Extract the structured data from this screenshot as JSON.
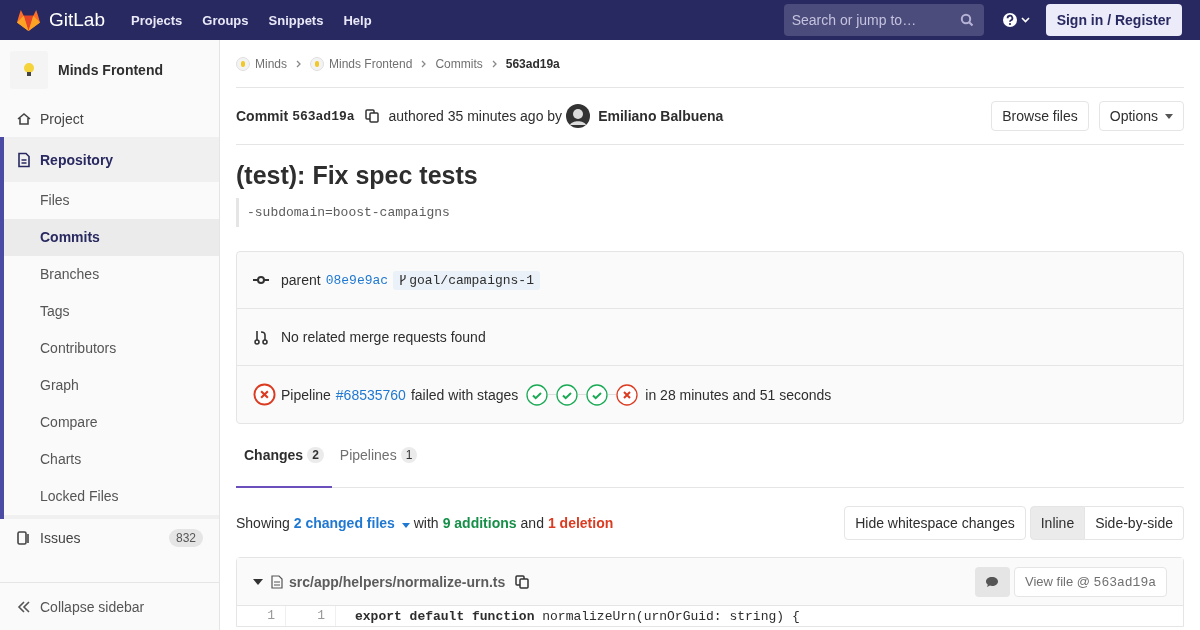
{
  "navbar": {
    "brand": "GitLab",
    "links": [
      "Projects",
      "Groups",
      "Snippets",
      "Help"
    ],
    "search": {
      "placeholder": "Search or jump to…"
    },
    "sign_in": "Sign in / Register"
  },
  "sidebar": {
    "project": "Minds Frontend",
    "items": [
      {
        "label": "Project",
        "selected": false
      },
      {
        "label": "Repository",
        "selected": true,
        "children": [
          {
            "label": "Files",
            "selected": false
          },
          {
            "label": "Commits",
            "selected": true
          },
          {
            "label": "Branches",
            "selected": false
          },
          {
            "label": "Tags",
            "selected": false
          },
          {
            "label": "Contributors",
            "selected": false
          },
          {
            "label": "Graph",
            "selected": false
          },
          {
            "label": "Compare",
            "selected": false
          },
          {
            "label": "Charts",
            "selected": false
          },
          {
            "label": "Locked Files",
            "selected": false
          }
        ]
      },
      {
        "label": "Issues",
        "selected": false,
        "count": "832"
      }
    ],
    "collapse": "Collapse sidebar"
  },
  "breadcrumbs": [
    {
      "label": "Minds",
      "avatar": true
    },
    {
      "label": "Minds Frontend",
      "avatar": true
    },
    {
      "label": "Commits",
      "avatar": false
    },
    {
      "label": "563ad19a",
      "avatar": false
    }
  ],
  "commit": {
    "label": "Commit",
    "sha": "563ad19a",
    "authored": "authored 35 minutes ago by",
    "author": "Emiliano Balbuena",
    "buttons": [
      "Browse files",
      "Options"
    ],
    "title": "(test): Fix spec tests",
    "description": "-subdomain=boost-campaigns"
  },
  "info": {
    "parent_label": "parent",
    "parent_sha": "08e9e9ac",
    "branch": "goal/campaigns-1",
    "merge_requests": "No related merge requests found",
    "pipeline": {
      "label": "Pipeline",
      "id": "#68535760",
      "passed": false,
      "text": "failed with stages",
      "stages": [
        {
          "passed": true
        },
        {
          "passed": true
        },
        {
          "passed": true
        },
        {
          "passed": false
        }
      ],
      "duration": "in 28 minutes and 51 seconds"
    }
  },
  "tabs": [
    {
      "label": "Changes",
      "count": "2",
      "selected": true
    },
    {
      "label": "Pipelines",
      "count": "1",
      "selected": false
    }
  ],
  "summary": {
    "showing": "Showing",
    "files": "2 changed files",
    "with": "with",
    "additions": "9 additions",
    "and": "and",
    "deletions": "1 deletion"
  },
  "diff_buttons": {
    "whitespace": "Hide whitespace changes",
    "views": [
      {
        "label": "Inline",
        "selected": true
      },
      {
        "label": "Side-by-side",
        "selected": false
      }
    ]
  },
  "file": {
    "path": "src/app/helpers/normalize-urn.ts",
    "view": "View file @",
    "view_sha": "563ad19a",
    "lines": [
      {
        "old": "1",
        "new": "1",
        "code": "**export default function** normalizeUrn(urnOrGuid: string) {"
      }
    ]
  }
}
